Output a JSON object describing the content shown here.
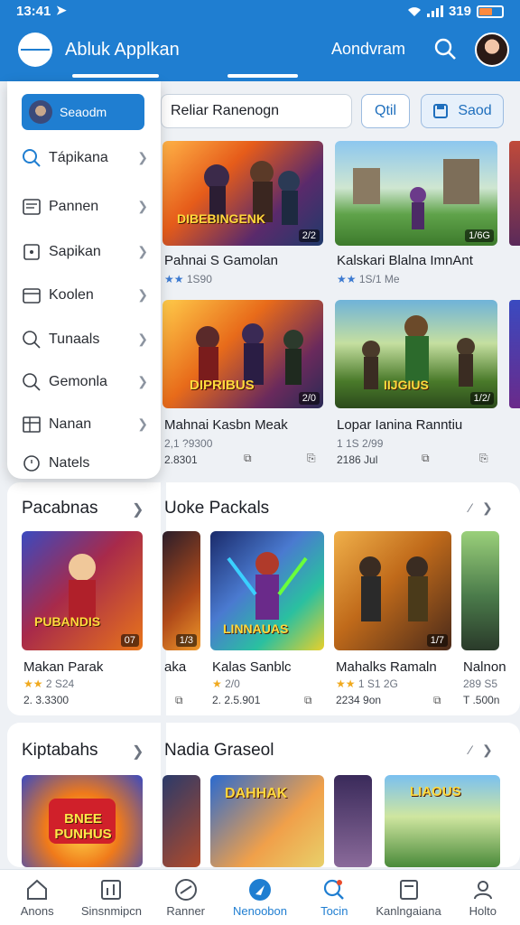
{
  "status": {
    "time": "13:41",
    "battery_text": "319",
    "accent": "#ff8a3d"
  },
  "appbar": {
    "title": "Abluk Applkan",
    "account_link": "Aondvram",
    "search_icon": "search-icon",
    "avatar": "avatar"
  },
  "search": {
    "value": "Reliar Ranenogn",
    "filter_label": "Qtil",
    "save_label": "Saod"
  },
  "drawer": {
    "active_label": "Seaodm",
    "items": [
      {
        "label": "Tápikana",
        "icon": "search-icon"
      },
      {
        "label": "Pannen",
        "icon": "document-icon"
      },
      {
        "label": "Sapikan",
        "icon": "grid-icon"
      },
      {
        "label": "Koolen",
        "icon": "calendar-icon"
      },
      {
        "label": "Tunaals",
        "icon": "search-icon"
      },
      {
        "label": "Gemonla",
        "icon": "search-icon"
      },
      {
        "label": "Nanan",
        "icon": "list-icon"
      },
      {
        "label": "Natels",
        "icon": "clock-icon"
      }
    ]
  },
  "featured": [
    {
      "title": "Pahnai S Gamolan",
      "art": "DIBEBINGENK",
      "badge": "2/2",
      "stars": "★★",
      "meta": "1S90"
    },
    {
      "title": "Kalskari Blalna ImnAnt",
      "art": "",
      "badge": "1/6G",
      "stars": "★★",
      "meta": "1S/1 Me"
    },
    {
      "title": "Mahnai Kasbn Meak",
      "art": "DIPRIBUS",
      "badge": "2/0",
      "stars": "",
      "meta": "2,1 ?9300",
      "sub": "2.8301"
    },
    {
      "title": "Lopar Ianina Ranntiu",
      "art": "IIJGIUS",
      "badge": "1/2/",
      "stars": "",
      "meta": "1 1S 2/99",
      "sub": "2186 Jul"
    }
  ],
  "section1": {
    "left_title": "Pacabnas",
    "title": "Uoke Packals",
    "games": [
      {
        "title": "Makan Parak",
        "art": "PUBANDIS",
        "badge": "07",
        "stars": "★★",
        "meta": "2 S24",
        "sub": "2. 3.3300"
      },
      {
        "title": "aka",
        "art": "",
        "badge": "1/3",
        "stars": "",
        "meta": "",
        "sub": ""
      },
      {
        "title": "Kalas Sanblc",
        "art": "LINNAUAS",
        "badge": "",
        "stars": "★",
        "meta": "2/0",
        "sub": "2. 2.5.901"
      },
      {
        "title": "Mahalks Ramaln",
        "art": "",
        "badge": "1/7",
        "stars": "★★",
        "meta": "1 S1 2G",
        "sub": "2234 9on"
      },
      {
        "title": "Nalnon",
        "art": "",
        "badge": "",
        "stars": "",
        "meta": "289 S5",
        "sub": "T .500n"
      }
    ]
  },
  "section2": {
    "left_title": "Kiptabahs",
    "title": "Nadia Graseol",
    "games": [
      {
        "art": "BNEE PUNHUS"
      },
      {
        "art": "DAHHAK"
      },
      {
        "art": "LIAOUS"
      }
    ]
  },
  "bottom_nav": [
    {
      "label": "Anons",
      "icon": "home-icon"
    },
    {
      "label": "Sinsnmipcn",
      "icon": "chart-icon"
    },
    {
      "label": "Ranner",
      "icon": "compass-icon"
    },
    {
      "label": "Nenoobon",
      "icon": "navigate-icon",
      "active": true
    },
    {
      "label": "Tocin",
      "icon": "search-icon"
    },
    {
      "label": "Kanlngaiana",
      "icon": "store-icon"
    },
    {
      "label": "Holto",
      "icon": "profile-icon"
    }
  ]
}
